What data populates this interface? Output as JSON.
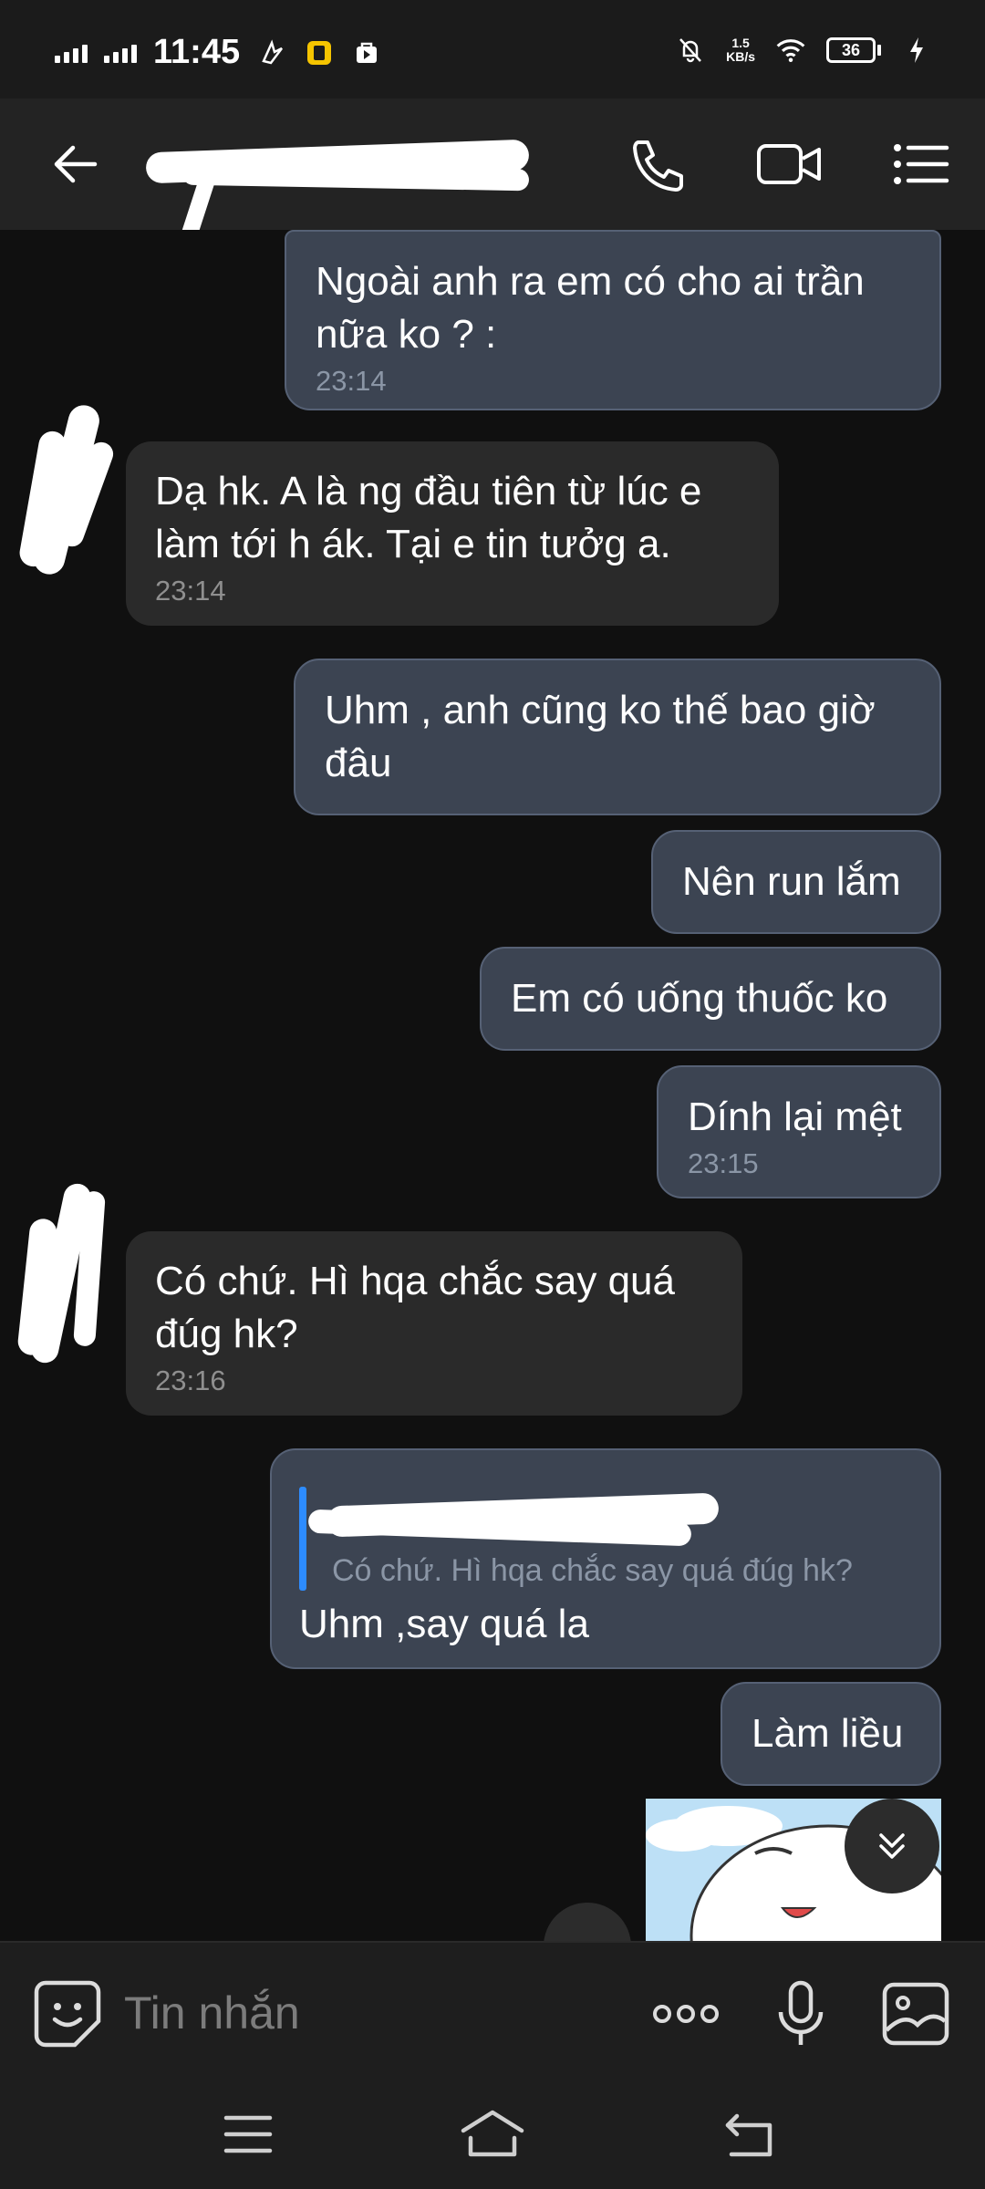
{
  "status_bar": {
    "time": "11:45",
    "net_speed_value": "1.5",
    "net_speed_unit": "KB/s",
    "battery_level": "36"
  },
  "header": {
    "contact_name_redacted": true
  },
  "messages": [
    {
      "direction": "out",
      "text": "Ngoài anh ra em có cho ai trần nữa ko ? :",
      "time": "23:14"
    },
    {
      "direction": "in",
      "text": "Dạ hk. A là ng đầu tiên từ lúc e làm tới h ák. Tại e tin tưởg a.",
      "time": "23:14"
    },
    {
      "direction": "out",
      "text": "Uhm , anh cũng ko thế bao giờ đâu",
      "time": ""
    },
    {
      "direction": "out",
      "text": "Nên run lắm",
      "time": ""
    },
    {
      "direction": "out",
      "text": "Em có uống thuốc ko",
      "time": ""
    },
    {
      "direction": "out",
      "text": "Dính lại mệt",
      "time": "23:15"
    },
    {
      "direction": "in",
      "text": "Có chứ. Hì hqa chắc say quá đúg hk?",
      "time": "23:16"
    },
    {
      "direction": "out",
      "quoted_text": "Có chứ. Hì hqa chắc say quá đúg hk?",
      "text": "Uhm ,say quá la",
      "time": ""
    },
    {
      "direction": "out",
      "text": "Làm liều",
      "time": ""
    }
  ],
  "input": {
    "placeholder": "Tin nhắn"
  },
  "icons": {
    "back": "arrow-left-icon",
    "call": "phone-icon",
    "video": "video-camera-icon",
    "menu": "list-menu-icon",
    "emoji": "sticker-smile-icon",
    "more": "more-dots-icon",
    "mic": "microphone-icon",
    "image": "image-gallery-icon",
    "scroll_down": "double-chevron-down-icon"
  },
  "colors": {
    "background": "#101010",
    "outgoing_bubble": "#3c4452",
    "incoming_bubble": "#2a2a2a",
    "quote_bar": "#2d8cff"
  }
}
